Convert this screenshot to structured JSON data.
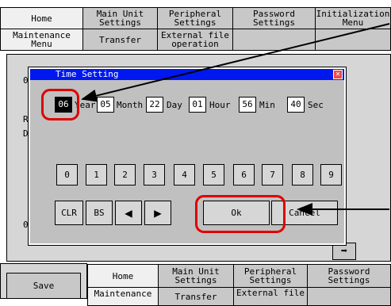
{
  "top_tabs": [
    "Home",
    "Main Unit\nSettings",
    "Peripheral\nSettings",
    "Password\nSettings",
    "Initialization\nMenu"
  ],
  "second_tabs": [
    "Maintenance\nMenu",
    "Transfer",
    "External file\noperation"
  ],
  "background_fragments": [
    "0",
    "R",
    "D",
    "0:"
  ],
  "dialog": {
    "title": "Time Setting",
    "close_glyph": "✕",
    "fields": [
      {
        "value": "06",
        "unit": "Year"
      },
      {
        "value": "05",
        "unit": "Month"
      },
      {
        "value": "22",
        "unit": "Day"
      },
      {
        "value": "01",
        "unit": "Hour"
      },
      {
        "value": "56",
        "unit": "Min"
      },
      {
        "value": "40",
        "unit": "Sec"
      }
    ],
    "keys": [
      "0",
      "1",
      "2",
      "3",
      "4",
      "5",
      "6",
      "7",
      "8",
      "9"
    ],
    "clr": "CLR",
    "bs": "BS",
    "left_arrow": "◀",
    "right_arrow": "▶",
    "ok": "Ok",
    "cancel": "Cancel"
  },
  "bottom": {
    "save": "Save",
    "next_arrow": "➡",
    "tabs": [
      "Home",
      "Main Unit\nSettings",
      "Peripheral\nSettings",
      "Password\nSettings"
    ],
    "tabs2": [
      "Maintenance",
      "Transfer",
      "External file"
    ]
  },
  "annotation_color": "#e00000",
  "titlebar_color": "#0018f0"
}
